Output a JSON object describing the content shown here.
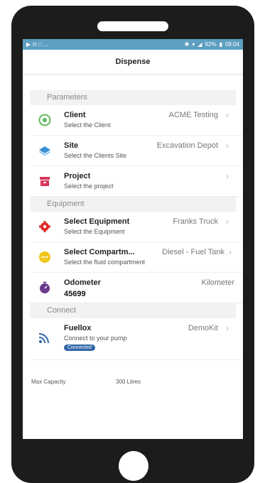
{
  "status": {
    "left": "▶ ⊙ □ ...",
    "battery": "92%",
    "time": "09:04"
  },
  "appbar": {
    "title": "Dispense"
  },
  "sections": {
    "parameters": "Parameters",
    "equipment": "Equipment",
    "connect": "Connect"
  },
  "rows": {
    "client": {
      "title": "Client",
      "sub": "Select the Client",
      "value": "ACME Testing"
    },
    "site": {
      "title": "Site",
      "sub": "Select the Clients Site",
      "value": "Excavation Depot"
    },
    "project": {
      "title": "Project",
      "sub": "Select the project",
      "value": ""
    },
    "equipment": {
      "title": "Select Equipment",
      "sub": "Select the Equipment",
      "value": "Franks Truck"
    },
    "compartment": {
      "title": "Select Compartm...",
      "sub": "Select the fluid compartment",
      "value": "Diesel - Fuel Tank"
    },
    "odometer": {
      "title": "Odometer",
      "value": "45699",
      "unit": "Kilometer"
    },
    "fuellox": {
      "title": "Fuellox",
      "sub": "Connect to your pump",
      "value": "DemoKit",
      "badge": "Connected"
    }
  },
  "footer": {
    "label": "Max Capacity",
    "value": "300 Litres"
  },
  "colors": {
    "statusbar": "#5d9fc0",
    "client_icon": "#5cb85c",
    "site_icon": "#3a8fd6",
    "project_icon": "#d9365a",
    "equipment_icon": "#e02a2a",
    "compartment_icon": "#f0c419",
    "odometer_icon": "#6a3b8c",
    "wifi_icon": "#2f66a8",
    "badge": "#2f66a8"
  }
}
